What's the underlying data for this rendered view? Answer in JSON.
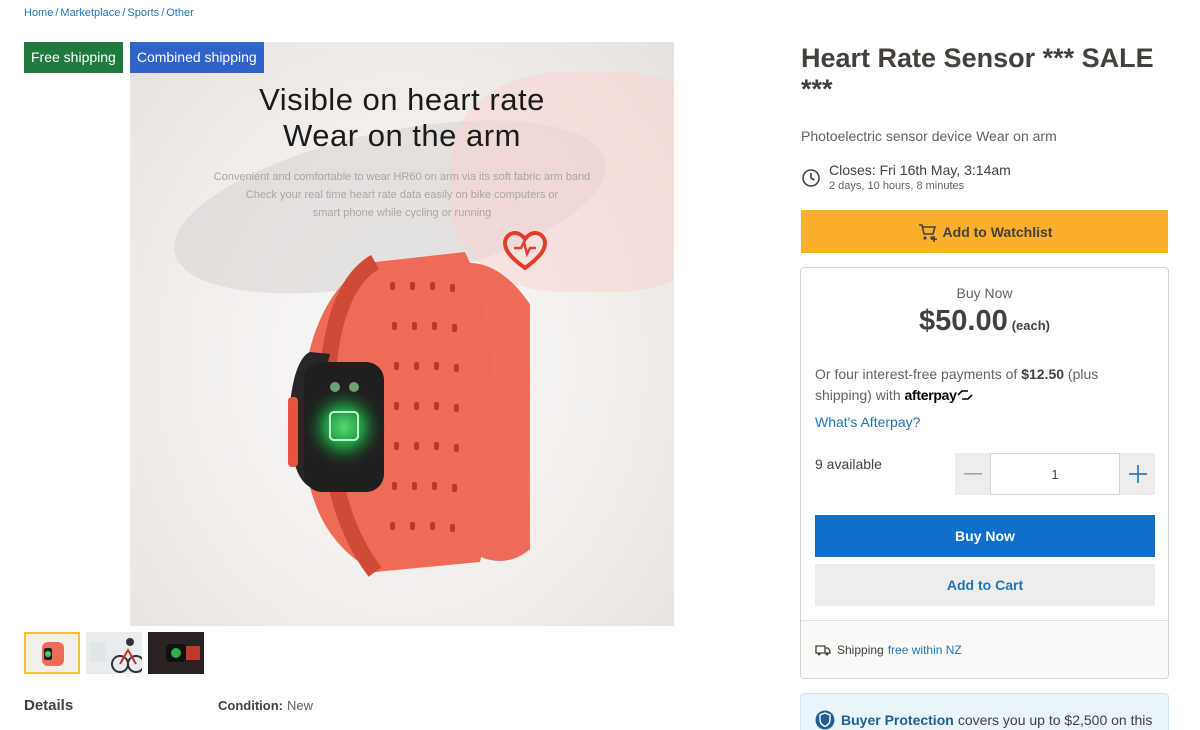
{
  "breadcrumb": [
    "Home",
    "Marketplace",
    "Sports",
    "Other"
  ],
  "badges": {
    "free_shipping": "Free shipping",
    "combined_shipping": "Combined shipping"
  },
  "hero": {
    "line1": "Visible on heart rate",
    "line2": "Wear on the arm",
    "desc1": "Convenient and comfortable to wear HR60 on arm via its soft fabric arm band",
    "desc2": "Check your real time heart rate data easily on bike computers or",
    "desc3": "smart phone while cycling or running"
  },
  "details": {
    "heading": "Details",
    "condition_label": "Condition:",
    "condition_value": "New"
  },
  "listing": {
    "title": "Heart Rate Sensor *** SALE ***",
    "subtitle": "Photoelectric sensor device Wear on arm",
    "closes": "Closes: Fri 16th May, 3:14am",
    "closes_remaining": "2 days, 10 hours, 8 minutes",
    "watchlist_label": "Add to Watchlist"
  },
  "buy": {
    "label": "Buy Now",
    "price": "$50.00",
    "each": "(each)",
    "afterpay_pre": "Or four interest-free payments of",
    "afterpay_amount": "$12.50",
    "afterpay_post": "(plus shipping) with",
    "afterpay_brand": "afterpay",
    "whats_afterpay": "What's Afterpay?",
    "available": "9 available",
    "quantity": "1",
    "buy_now_button": "Buy Now",
    "add_to_cart_button": "Add to Cart",
    "shipping_label": "Shipping",
    "shipping_value": "free within NZ"
  },
  "protection": {
    "title": "Buyer Protection",
    "text": "covers you up to $2,500 on this"
  },
  "colors": {
    "accent_blue": "#0e6fcb",
    "watchlist_yellow": "#f9af2c",
    "free_ship_green": "#1f7a3e",
    "combined_ship_blue": "#2f63c8"
  }
}
